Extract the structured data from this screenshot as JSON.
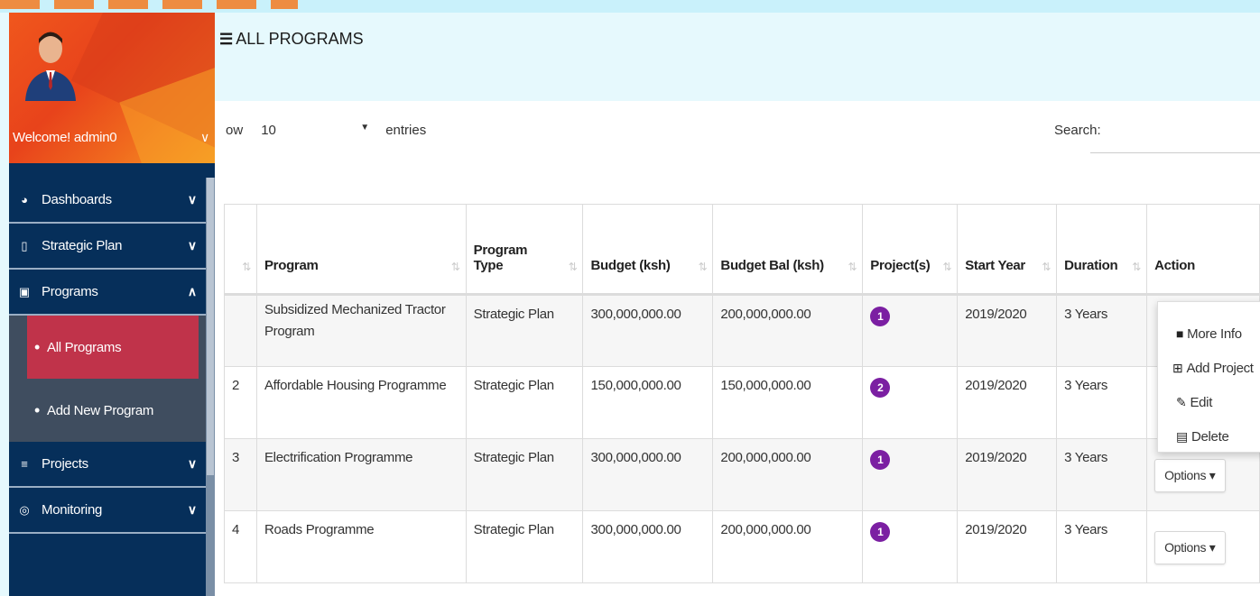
{
  "sidebar": {
    "welcome": "Welcome! admin0",
    "nav": [
      {
        "label": "Dashboards",
        "icon": "dashboard-icon",
        "chevron": "∨"
      },
      {
        "label": "Strategic Plan",
        "icon": "book-icon",
        "chevron": "∨"
      },
      {
        "label": "Programs",
        "icon": "programs-icon",
        "chevron": "∧"
      },
      {
        "label": "Projects",
        "icon": "projects-icon",
        "chevron": "∨"
      },
      {
        "label": "Monitoring",
        "icon": "monitoring-icon",
        "chevron": "∨"
      }
    ],
    "sub": [
      {
        "label": "All Programs",
        "active": true
      },
      {
        "label": "Add New Program",
        "active": false
      }
    ]
  },
  "main": {
    "title": "ALL PROGRAMS",
    "show_prefix": "ow",
    "page_length": "10",
    "entries_label": "entries",
    "search_label": "Search:"
  },
  "table": {
    "headers": [
      "",
      "Program",
      "Program Type",
      "Budget (ksh)",
      "Budget Bal (ksh)",
      "Project(s)",
      "Start Year",
      "Duration",
      "Action"
    ],
    "rows": [
      {
        "num": "",
        "program": "Subsidized Mechanized Tractor Program",
        "type": "Strategic Plan",
        "budget": "300,000,000.00",
        "bal": "200,000,000.00",
        "projects": "1",
        "start": "2019/2020",
        "duration": "3 Years",
        "action": ""
      },
      {
        "num": "2",
        "program": "Affordable Housing Programme",
        "type": "Strategic Plan",
        "budget": "150,000,000.00",
        "bal": "150,000,000.00",
        "projects": "2",
        "start": "2019/2020",
        "duration": "3 Years",
        "action": ""
      },
      {
        "num": "3",
        "program": "Electrification Programme",
        "type": "Strategic Plan",
        "budget": "300,000,000.00",
        "bal": "200,000,000.00",
        "projects": "1",
        "start": "2019/2020",
        "duration": "3 Years",
        "action": "Options ▾"
      },
      {
        "num": "4",
        "program": "Roads Programme",
        "type": "Strategic Plan",
        "budget": "300,000,000.00",
        "bal": "200,000,000.00",
        "projects": "1",
        "start": "2019/2020",
        "duration": "3 Years",
        "action": "Options ▾"
      }
    ]
  },
  "dropdown": {
    "items": [
      {
        "label": "More Info",
        "icon": "file-icon"
      },
      {
        "label": "Add Project",
        "icon": "plus-square-icon"
      },
      {
        "label": "Edit",
        "icon": "edit-icon"
      },
      {
        "label": "Delete",
        "icon": "trash-icon"
      }
    ]
  },
  "colors": {
    "sidebar": "#062f5a",
    "active": "#c0334a",
    "badge": "#7b1fa2",
    "background": "#e6f9fd"
  }
}
